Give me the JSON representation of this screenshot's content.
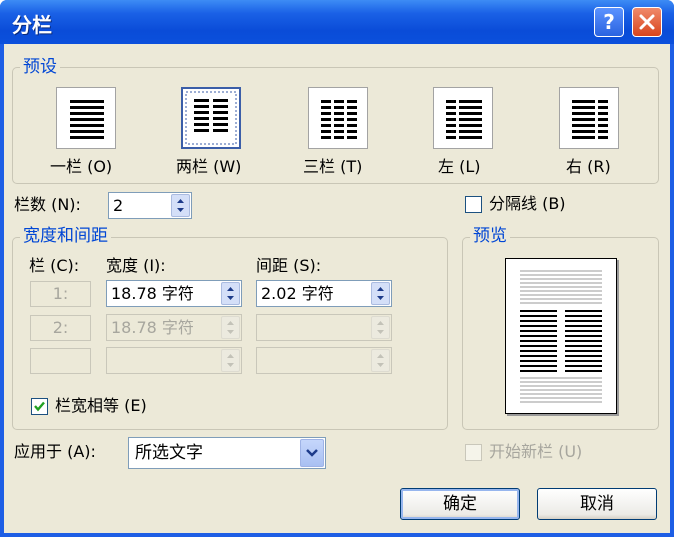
{
  "window": {
    "title": "分栏",
    "help_label": "?",
    "close_label": "×"
  },
  "presets": {
    "label": "预设",
    "items": [
      {
        "label": "一栏 (O)",
        "icon": "one-column-icon"
      },
      {
        "label": "两栏 (W)",
        "icon": "two-columns-icon",
        "selected": true
      },
      {
        "label": "三栏 (T)",
        "icon": "three-columns-icon"
      },
      {
        "label": "左 (L)",
        "icon": "left-column-icon"
      },
      {
        "label": "右 (R)",
        "icon": "right-column-icon"
      }
    ]
  },
  "columns_count": {
    "label": "栏数 (N):",
    "value": "2"
  },
  "line_between": {
    "label": "分隔线 (B)",
    "checked": false
  },
  "width_spacing": {
    "label": "宽度和间距",
    "col_header": "栏 (C):",
    "width_header": "宽度 (I):",
    "spacing_header": "间距 (S):",
    "rows": [
      {
        "num": "1:",
        "width": "18.78 字符",
        "spacing": "2.02 字符",
        "enabled": true
      },
      {
        "num": "2:",
        "width": "18.78 字符",
        "spacing": "",
        "enabled": false
      },
      {
        "num": "",
        "width": "",
        "spacing": "",
        "enabled": false
      }
    ],
    "equal_width": {
      "label": "栏宽相等 (E)",
      "checked": true
    }
  },
  "preview": {
    "label": "预览"
  },
  "apply_to": {
    "label": "应用于 (A):",
    "value": "所选文字"
  },
  "new_column": {
    "label": "开始新栏 (U)",
    "checked": false,
    "enabled": false
  },
  "buttons": {
    "ok": "确定",
    "cancel": "取消"
  },
  "colors": {
    "accent": "#0046d5",
    "titlebar": "#0a4cd8",
    "face": "#ece9d8"
  }
}
